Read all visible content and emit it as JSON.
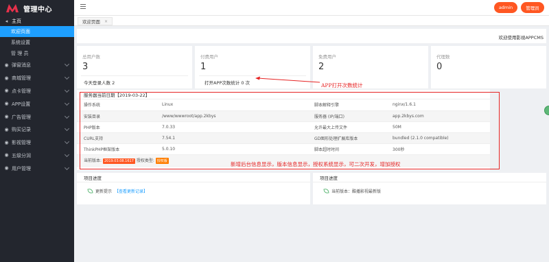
{
  "app": {
    "title": "管理中心"
  },
  "colors": {
    "sidebar_bg": "#23262e",
    "accent_blue": "#1e9fff",
    "accent_orange": "#ff5722",
    "annotation_red": "#e62222",
    "badge_red": "#ff5722",
    "badge_orange": "#ff7e00"
  },
  "sidebar": {
    "head_label": "主页",
    "subs": [
      {
        "label": "欢迎页面",
        "active": true
      },
      {
        "label": "系统设置",
        "active": false
      },
      {
        "label": "管 理 员",
        "active": false
      }
    ],
    "items": [
      {
        "label": "弹窗消息",
        "icon": "bell-icon"
      },
      {
        "label": "商城管理",
        "icon": "cart-icon"
      },
      {
        "label": "点卡管理",
        "icon": "card-icon"
      },
      {
        "label": "APP设置",
        "icon": "phone-icon"
      },
      {
        "label": "广告管理",
        "icon": "ad-icon"
      },
      {
        "label": "购买记录",
        "icon": "receipt-icon"
      },
      {
        "label": "影视管理",
        "icon": "film-icon"
      },
      {
        "label": "五级分润",
        "icon": "share-icon"
      },
      {
        "label": "用户管理",
        "icon": "user-icon"
      }
    ]
  },
  "header": {
    "btn1": "admin",
    "btn2": "管理员"
  },
  "tabs": [
    {
      "label": "欢迎页面",
      "close": "×"
    }
  ],
  "welcome": {
    "text": "欢迎使用影视APPCMS"
  },
  "stats": [
    {
      "title": "总用户数",
      "value": "3",
      "foot": "今天登录人数   2"
    },
    {
      "title": "付费用户",
      "value": "1",
      "foot": "打开APP次数统计    0 次"
    },
    {
      "title": "免费用户",
      "value": "2",
      "foot": ""
    },
    {
      "title": "代理数",
      "value": "0",
      "foot": ""
    }
  ],
  "server": {
    "title": "服务器当前日期【2019-03-22】",
    "rows": [
      [
        "操作系统",
        "Linux",
        "脚本解释引擎",
        "nginx/1.6.1"
      ],
      [
        "安装目录",
        "/www/wwwroot/app.2kbys",
        "服务器 (IP/端口)",
        "app.2kbys.com"
      ],
      [
        "PHP版本",
        "7.0.33",
        "允许最大上传文件",
        "50M"
      ],
      [
        "CURL支持",
        "7.54.1",
        "GD图形处理扩展库版本",
        "bundled (2.1.0 compatible)"
      ],
      [
        "ThinkPHP框架版本",
        "5.0.10",
        "脚本超时时间",
        "300秒"
      ]
    ],
    "version_label": "当前版本:",
    "version_value": "2019.03.08.1617",
    "auth_label": "授权类型:",
    "auth_value": "授权版"
  },
  "annotations": {
    "app_stat": "APP打开次数统计",
    "main": "新增后台信息显示，版本信息显示，授权系统显示，可二次开发，增加授权"
  },
  "progress": [
    {
      "title": "项目进度",
      "text": "更新提示",
      "link": "【查看更新记录】"
    },
    {
      "title": "项目进度",
      "text": "当前版本：酷播影视最新版",
      "link": ""
    }
  ]
}
